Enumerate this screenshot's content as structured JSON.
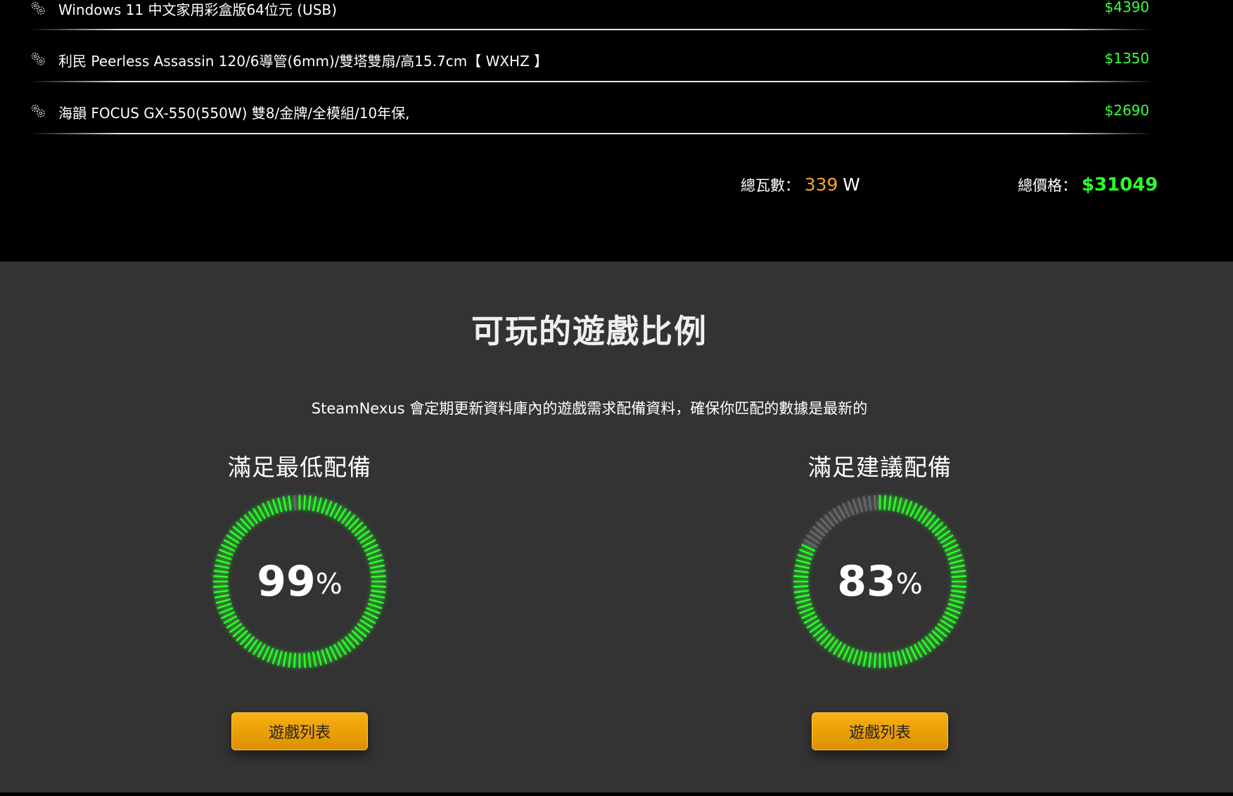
{
  "parts": [
    {
      "icon": "gears-icon",
      "name": "Windows 11 中文家用彩盒版64位元 (USB)",
      "price": "$4390"
    },
    {
      "icon": "gears-icon",
      "name": "利民 Peerless Assassin 120/6導管(6mm)/雙塔雙扇/高15.7cm【 WXHZ 】",
      "price": "$1350"
    },
    {
      "icon": "gears-icon",
      "name": "海韻 FOCUS GX-550(550W) 雙8/金牌/全模組/10年保,",
      "price": "$2690"
    }
  ],
  "totals": {
    "watt_label": "總瓦數：",
    "watt_value": "339",
    "watt_unit": "W",
    "price_label": "總價格：",
    "price_value": "$31049"
  },
  "playable": {
    "title": "可玩的遊戲比例",
    "subtitle": "SteamNexus 會定期更新資料庫內的遊戲需求配備資料，確保你匹配的數據是最新的",
    "minimum": {
      "label": "滿足最低配備",
      "percent": 99,
      "percent_text": "99",
      "percent_sign": "%",
      "button": "遊戲列表"
    },
    "recommended": {
      "label": "滿足建議配備",
      "percent": 83,
      "percent_text": "83",
      "percent_sign": "%",
      "button": "遊戲列表"
    }
  },
  "colors": {
    "active_tick": "#2cff2c",
    "inactive_tick": "#6a6a6a",
    "price_green": "#3cff3c",
    "watt_orange": "#f5a623",
    "button_orange": "#f0a30a"
  }
}
